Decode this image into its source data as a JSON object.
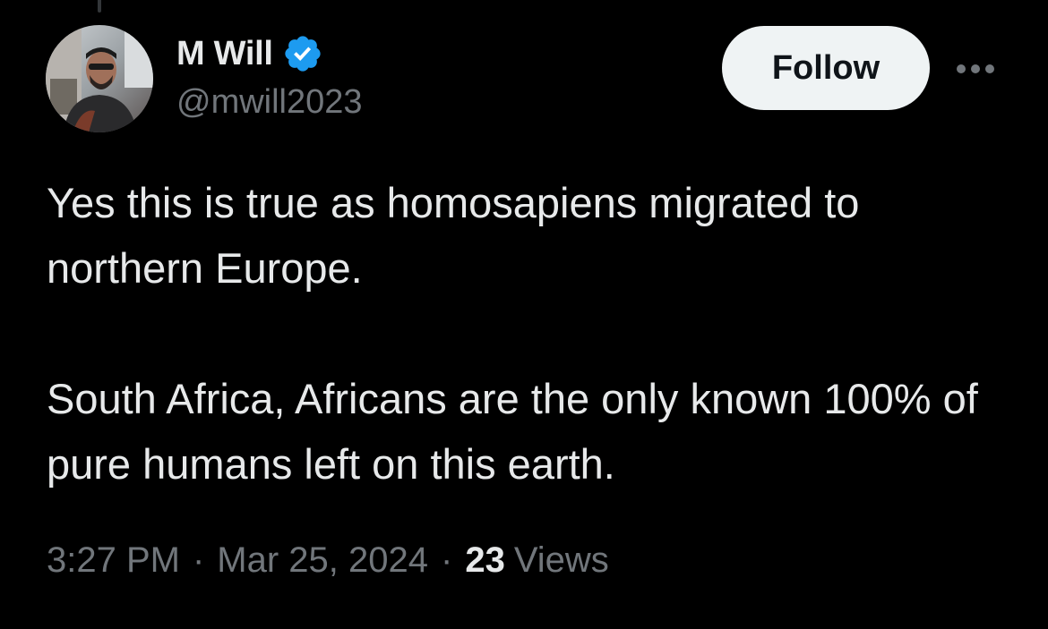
{
  "tweet": {
    "author": {
      "display_name": "M Will",
      "handle": "@mwill2023",
      "verified": true
    },
    "follow_label": "Follow",
    "more_icon": "more-horizontal-icon",
    "text_paragraphs": [
      "Yes this is true as homosapiens migrated to northern Europe.",
      "South Africa, Africans are the only known 100% of pure humans left on this earth."
    ],
    "time": "3:27 PM",
    "date": "Mar 25, 2024",
    "separator": "·",
    "views_count": "23",
    "views_label": "Views"
  },
  "colors": {
    "background": "#000000",
    "primary_text": "#e7e9ea",
    "secondary_text": "#71767b",
    "verified_badge": "#1d9bf0",
    "follow_bg": "#eff3f4"
  }
}
